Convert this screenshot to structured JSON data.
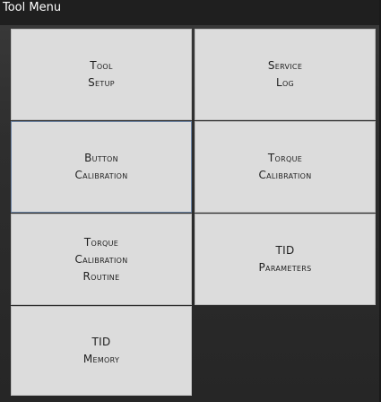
{
  "window": {
    "title": "Tool Menu"
  },
  "menu": {
    "items": [
      {
        "line1": "Tool",
        "line2": "Setup",
        "line3": ""
      },
      {
        "line1": "Service",
        "line2": "Log",
        "line3": ""
      },
      {
        "line1": "Button",
        "line2": "Calibration",
        "line3": ""
      },
      {
        "line1": "Torque",
        "line2": "Calibration",
        "line3": ""
      },
      {
        "line1": "Torque",
        "line2": "Calibration",
        "line3": "Routine"
      },
      {
        "line1": "TID",
        "line2": "Parameters",
        "line3": ""
      },
      {
        "line1": "TID",
        "line2": "Memory",
        "line3": ""
      }
    ],
    "selected_index": 2
  },
  "colors": {
    "tile_background": "#dcdcdc",
    "window_background": "#2b2b2b",
    "title_background": "#1f1f1f",
    "selected_border": "#6f86a6"
  }
}
